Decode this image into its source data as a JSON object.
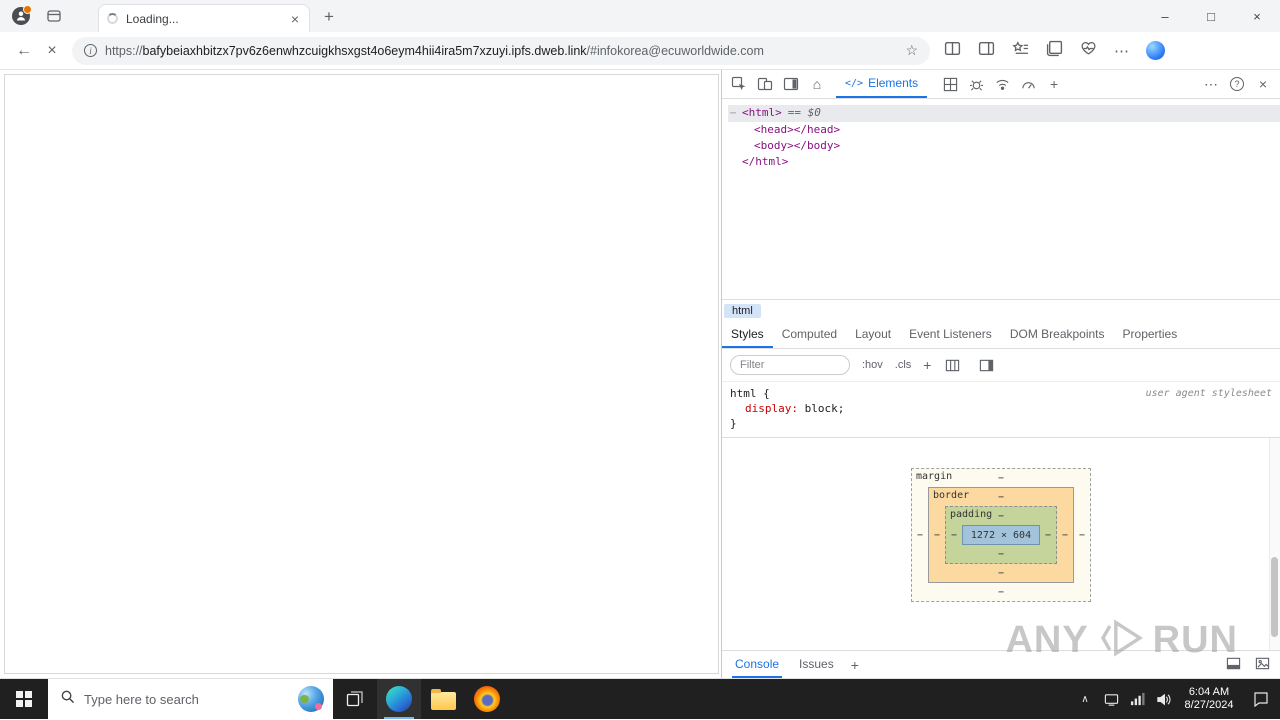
{
  "window": {
    "tab_title": "Loading...",
    "tab_close": "×",
    "controls": {
      "minimize": "–",
      "maximize": "□",
      "close": "×"
    }
  },
  "toolbar": {
    "back": "←",
    "stop": "×",
    "info": "i",
    "star": "☆",
    "more": "⋯",
    "new_tab": "+"
  },
  "url": {
    "scheme": "https://",
    "host": "bafybeiaxhbitzx7pv6z6enwhzcuigkhsxgst4o6eym4hii4ira5m7xzuyi.ipfs.dweb.link",
    "path": "/#infokorea@ecuworldwide.com"
  },
  "devtools": {
    "toolbar": {
      "home": "⌂",
      "elements_glyph": "</>",
      "elements_label": "Elements",
      "plus": "+",
      "more": "⋯",
      "help": "?",
      "close": "×"
    },
    "dom": {
      "node_menu": "⋯",
      "root_open": "<html>",
      "selected_hint": "== $0",
      "head": "<head></head>",
      "body": "<body></body>",
      "root_close": "</html>"
    },
    "breadcrumb": "html",
    "panel_tabs": [
      "Styles",
      "Computed",
      "Layout",
      "Event Listeners",
      "DOM Breakpoints",
      "Properties"
    ],
    "styles": {
      "filter_placeholder": "Filter",
      "hov": ":hov",
      "cls": ".cls",
      "plus": "+",
      "selector": "html {",
      "property": "display:",
      "value": "block;",
      "close": "}",
      "source": "user agent stylesheet"
    },
    "box_model": {
      "margin": "margin",
      "border": "border",
      "padding": "padding",
      "dash": "−",
      "content": "1272 × 604"
    },
    "drawer": {
      "console": "Console",
      "issues": "Issues",
      "plus": "+"
    }
  },
  "watermark": {
    "left": "ANY",
    "right": "RUN"
  },
  "taskbar": {
    "search_placeholder": "Type here to search",
    "chevron": "∧",
    "time": "6:04 AM",
    "date": "8/27/2024"
  }
}
